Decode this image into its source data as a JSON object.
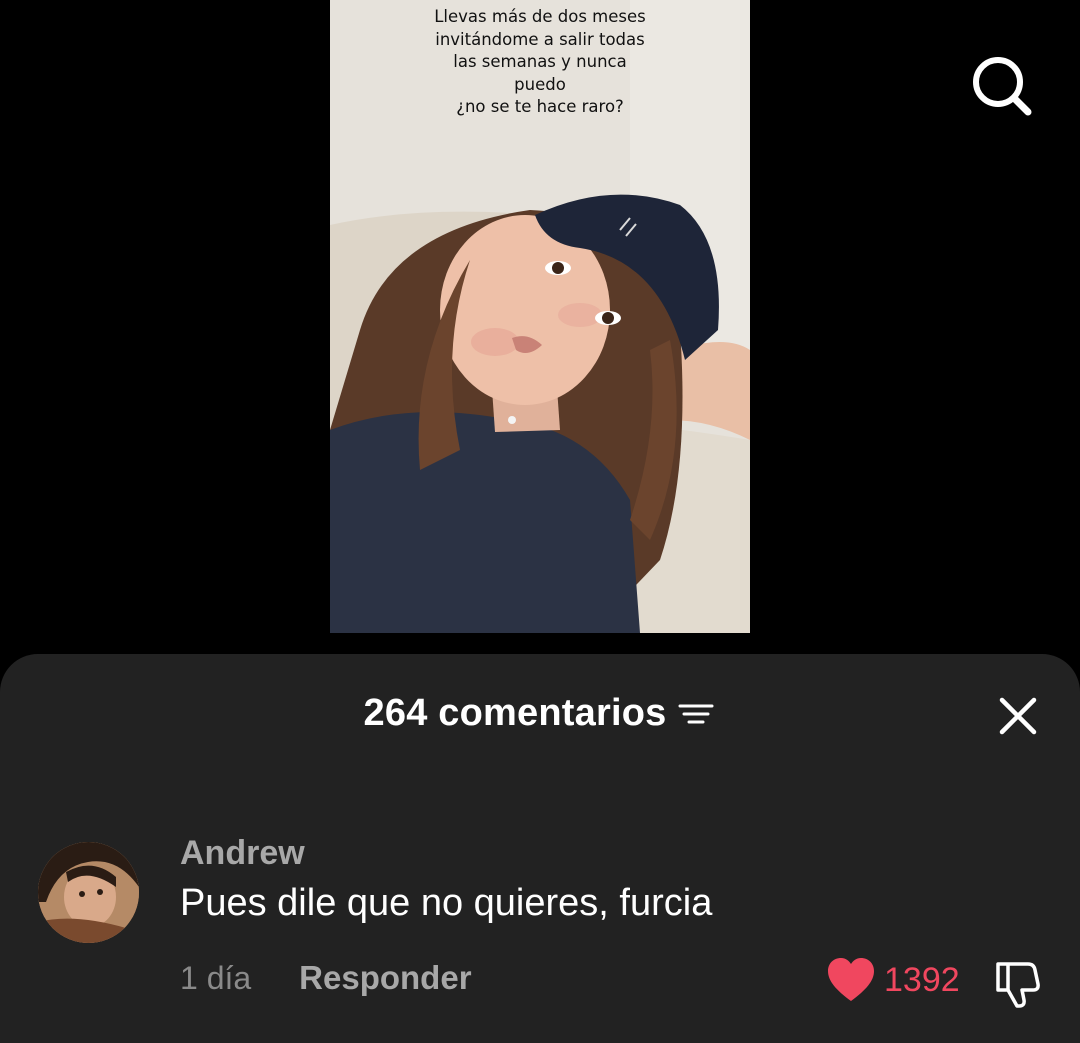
{
  "video": {
    "caption_lines": [
      "Llevas más de dos meses",
      "invitándome a salir todas",
      "las semanas y nunca",
      "puedo",
      "¿no se te hace raro?"
    ]
  },
  "top_bar": {
    "search_icon": "search-icon"
  },
  "comments_sheet": {
    "title": "264 comentarios",
    "sort_icon": "filter-lines-icon",
    "close_icon": "close-icon",
    "comments": [
      {
        "username": "Andrew",
        "text": "Pues dile que no quieres, furcia",
        "time": "1 día",
        "reply_label": "Responder",
        "likes": "1392",
        "liked": true,
        "like_icon": "heart-icon",
        "dislike_icon": "thumbs-down-icon"
      }
    ]
  },
  "colors": {
    "background": "#000000",
    "sheet": "#222222",
    "like": "#f0475f",
    "muted_text": "#a8a8a8"
  }
}
